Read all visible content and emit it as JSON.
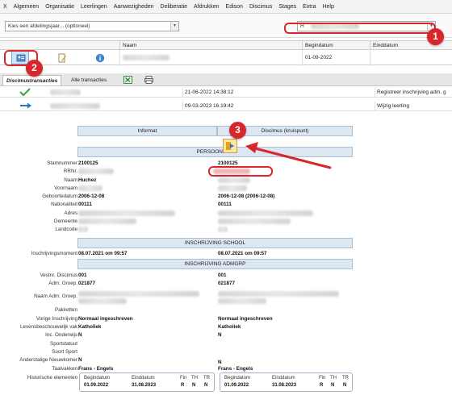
{
  "menu": [
    "X",
    "Algemeen",
    "Organisatie",
    "Leerlingen",
    "Aanwezigheden",
    "Deliberatie",
    "Afdrukken",
    "Edison",
    "Discimus",
    "Stages",
    "Extra",
    "Help"
  ],
  "toolbar": {
    "department_placeholder": "Kies een afdelingsjaar... (optioneel)",
    "search_value": "H"
  },
  "grid": {
    "columns": {
      "name": "Naam",
      "start": "Begindatum",
      "end": "Einddatum"
    },
    "row": {
      "start": "01-09-2022"
    }
  },
  "tabs": {
    "discimus": "Discimustransacties",
    "all": "Alle transacties"
  },
  "transactions": [
    {
      "datetime": "21-06-2022 14:38:12",
      "action": "Registreer inschrijving adm. g"
    },
    {
      "datetime": "09-03-2023 16:19:42",
      "action": "Wijzig leerling"
    }
  ],
  "detail": {
    "col_informat": "Informat",
    "col_discimus": "Discimus (kruispunt)",
    "section_person": "PERSOON",
    "section_school": "INSCHRIJVING SCHOOL",
    "section_admgrp": "INSCHRIJVING ADMGRP",
    "labels": {
      "stamnummer": "Stamnummer",
      "rrnr": "RRNr.",
      "naam": "Naam",
      "voornaam": "Voornaam",
      "geboortedatum": "Geboortedatum",
      "nationaliteit": "Nationaliteit",
      "adres": "Adres",
      "gemeente": "Gemeente",
      "landcode": "Landcode",
      "inschrijvingsmoment": "Inschrijvingsmoment",
      "vestnr": "Vestnr. Discimus",
      "admgroep": "Adm. Groep.",
      "naamadm": "Naam Adm. Groep.",
      "pakketten": "Pakketten",
      "vorige": "Vorige Inschrijving",
      "levensbeschouwelijk": "Levensbeschouwelijk vak",
      "incond": "Inc. Onderwijs",
      "sportstatuut": "Sportstatuut",
      "soortsport": "Soort Sport",
      "anderstalige": "Anderstalige Nieuwkomer",
      "taalvakken": "Taalvakken",
      "historische": "Historische elementen"
    },
    "left": {
      "stamnummer": "2100125",
      "naam": "Huchez",
      "geboortedatum": "2006-12-08",
      "nationaliteit": "00111",
      "inschrijvingsmoment": "08.07.2021 om 09:57",
      "vestnr": "001",
      "admgroep": "021877",
      "vorige": "Normaal ingeschreven",
      "levensbeschouwelijk": "Katholiek",
      "incond": "N",
      "anderstalige": "N",
      "taalvakken": "Frans - Engels"
    },
    "right": {
      "stamnummer": "2100125",
      "geboortedatum": "2006-12-08 (2006-12-08)",
      "nationaliteit": "00111",
      "inschrijvingsmoment": "08.07.2021 om 09:57",
      "vestnr": "001",
      "admgroep": "021877",
      "vorige": "Normaal ingeschreven",
      "levensbeschouwelijk": "Katholiek",
      "incond": "N",
      "anderstalige": "N",
      "taalvakken": "Frans - Engels"
    },
    "history_headers": {
      "start": "Begindatum",
      "end": "Einddatum",
      "fin": "Fin",
      "th": "TH",
      "tr": "TR"
    },
    "history_left": {
      "start": "01.09.2022",
      "end": "31.08.2023",
      "fin": "R",
      "th": "N",
      "tr": "N"
    },
    "history_right": {
      "start": "01.09.2022",
      "end": "31.08.2023",
      "fin": "R",
      "th": "N",
      "tr": "N"
    }
  },
  "callouts": {
    "one": "1",
    "two": "2",
    "three": "3"
  },
  "colors": {
    "accent_red": "#d9262a",
    "header_blue": "#dde7f2"
  }
}
